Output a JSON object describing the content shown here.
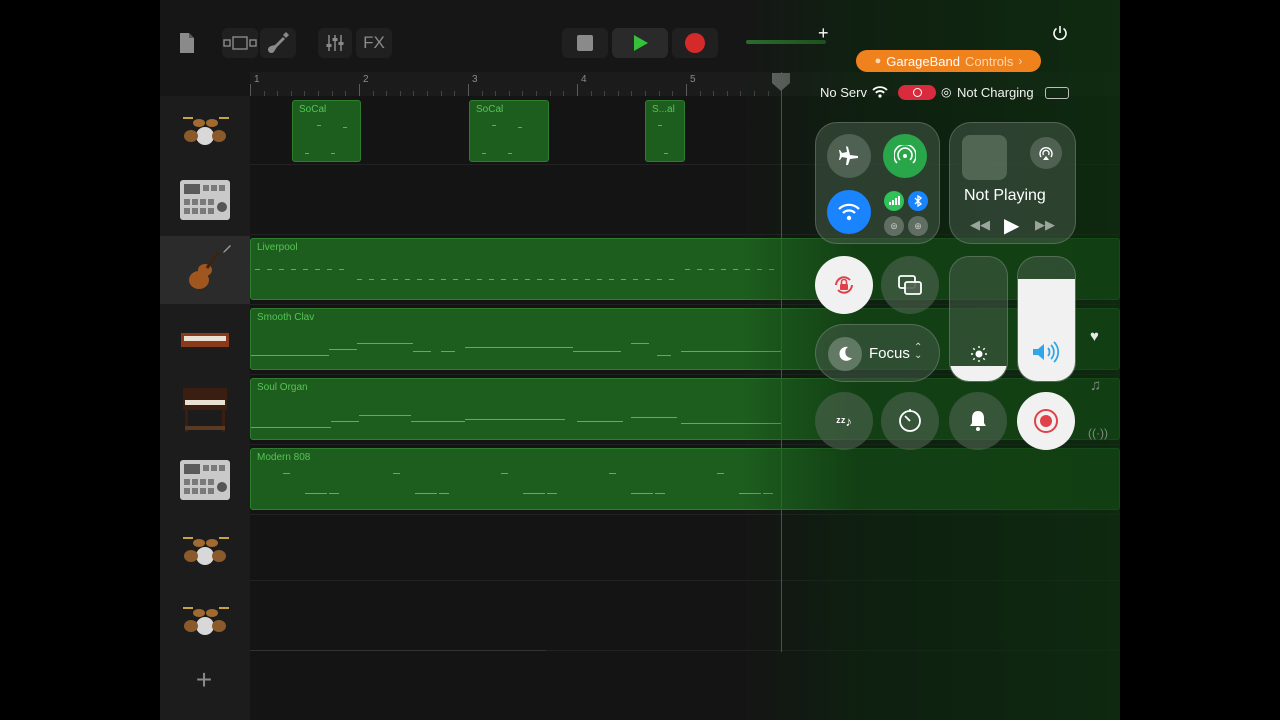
{
  "toolbar": {
    "fx_label": "FX"
  },
  "ruler": {
    "bars": [
      "1",
      "2",
      "3",
      "4",
      "5"
    ]
  },
  "tracks": [
    {
      "instrument": "drum-kit"
    },
    {
      "instrument": "beat-machine"
    },
    {
      "instrument": "violin"
    },
    {
      "instrument": "keyboard-clav"
    },
    {
      "instrument": "organ"
    },
    {
      "instrument": "beat-machine"
    },
    {
      "instrument": "drum-kit"
    },
    {
      "instrument": "drum-kit"
    }
  ],
  "regions": {
    "socal_1": "SoCal",
    "socal_2": "SoCal",
    "socal_3": "S...al",
    "liverpool": "Liverpool",
    "smooth_clav": "Smooth Clav",
    "soul_organ": "Soul Organ",
    "modern_808": "Modern 808"
  },
  "control_center": {
    "app_pill": "GarageBand",
    "app_pill_suffix": "Controls",
    "status_service": "No Serv",
    "status_charging": "Not Charging",
    "now_playing": "Not Playing",
    "focus_label": "Focus",
    "brightness_level": 0.12,
    "volume_level": 0.82,
    "colors": {
      "wifi_blue": "#1a84ff",
      "cellular_green": "#30c158",
      "record_red": "#ff3b30",
      "pill_orange": "#f0821e"
    }
  }
}
